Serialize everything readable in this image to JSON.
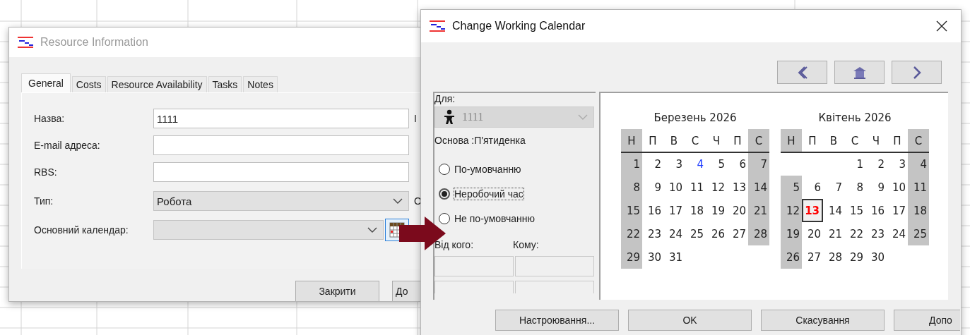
{
  "resource_window": {
    "title": "Resource Information",
    "active": false,
    "tabs": [
      {
        "label": "General",
        "selected": true
      },
      {
        "label": "Costs",
        "selected": false
      },
      {
        "label": "Resource Availability",
        "selected": false
      },
      {
        "label": "Tasks",
        "selected": false
      },
      {
        "label": "Notes",
        "selected": false
      }
    ],
    "fields": [
      {
        "kind": "text",
        "label": "Назва:",
        "value": "1111",
        "side_text": "І"
      },
      {
        "kind": "text",
        "label": "E-mail адреса:"
      },
      {
        "kind": "text",
        "label": "RBS:"
      },
      {
        "kind": "select",
        "label": "Тип:",
        "value": "Робота",
        "side_text": "О"
      },
      {
        "kind": "select",
        "label": "Основний календар:",
        "calendar_button": true
      }
    ],
    "buttons": [
      "Закрити",
      "До"
    ]
  },
  "calendar_window": {
    "title": "Change Working Calendar",
    "active": true,
    "for_label": "Для:",
    "resource": {
      "value": "1111",
      "disabled": true
    },
    "base_text": "Основа :П'ятиденка",
    "options": [
      {
        "label": "По-умовчанню",
        "selected": false,
        "focused": false
      },
      {
        "label": "Неробочий час",
        "selected": true,
        "focused": true
      },
      {
        "label": "Не по-умовчанню",
        "selected": false,
        "focused": false
      }
    ],
    "from_label": "Від кого:",
    "to_label": "Кому:",
    "months": [
      {
        "title": "Березень 2026",
        "weekdays": [
          {
            "label": "Н",
            "weekend": true
          },
          {
            "label": "П",
            "weekend": false
          },
          {
            "label": "В",
            "weekend": false
          },
          {
            "label": "С",
            "weekend": false
          },
          {
            "label": "Ч",
            "weekend": false
          },
          {
            "label": "П",
            "weekend": false
          },
          {
            "label": "С",
            "weekend": true
          }
        ],
        "weeks": [
          [
            {
              "day": "1",
              "weekend": true,
              "selected": false,
              "exception": false
            },
            {
              "day": "2",
              "weekend": false,
              "selected": false,
              "exception": false
            },
            {
              "day": "3",
              "weekend": false,
              "selected": false,
              "exception": false
            },
            {
              "day": "4",
              "weekend": false,
              "selected": false,
              "exception": true
            },
            {
              "day": "5",
              "weekend": false,
              "selected": false,
              "exception": false
            },
            {
              "day": "6",
              "weekend": false,
              "selected": false,
              "exception": false
            },
            {
              "day": "7",
              "weekend": true,
              "selected": false,
              "exception": false
            }
          ],
          [
            {
              "day": "8",
              "weekend": true,
              "selected": false,
              "exception": false
            },
            {
              "day": "9",
              "weekend": false,
              "selected": false,
              "exception": false
            },
            {
              "day": "10",
              "weekend": false,
              "selected": false,
              "exception": false
            },
            {
              "day": "11",
              "weekend": false,
              "selected": false,
              "exception": false
            },
            {
              "day": "12",
              "weekend": false,
              "selected": false,
              "exception": false
            },
            {
              "day": "13",
              "weekend": false,
              "selected": false,
              "exception": false
            },
            {
              "day": "14",
              "weekend": true,
              "selected": false,
              "exception": false
            }
          ],
          [
            {
              "day": "15",
              "weekend": true,
              "selected": false,
              "exception": false
            },
            {
              "day": "16",
              "weekend": false,
              "selected": false,
              "exception": false
            },
            {
              "day": "17",
              "weekend": false,
              "selected": false,
              "exception": false
            },
            {
              "day": "18",
              "weekend": false,
              "selected": false,
              "exception": false
            },
            {
              "day": "19",
              "weekend": false,
              "selected": false,
              "exception": false
            },
            {
              "day": "20",
              "weekend": false,
              "selected": false,
              "exception": false
            },
            {
              "day": "21",
              "weekend": true,
              "selected": false,
              "exception": false
            }
          ],
          [
            {
              "day": "22",
              "weekend": true,
              "selected": false,
              "exception": false
            },
            {
              "day": "23",
              "weekend": false,
              "selected": false,
              "exception": false
            },
            {
              "day": "24",
              "weekend": false,
              "selected": false,
              "exception": false
            },
            {
              "day": "25",
              "weekend": false,
              "selected": false,
              "exception": false
            },
            {
              "day": "26",
              "weekend": false,
              "selected": false,
              "exception": false
            },
            {
              "day": "27",
              "weekend": false,
              "selected": false,
              "exception": false
            },
            {
              "day": "28",
              "weekend": true,
              "selected": false,
              "exception": false
            }
          ],
          [
            {
              "day": "29",
              "weekend": true,
              "selected": false,
              "exception": false
            },
            {
              "day": "30",
              "weekend": false,
              "selected": false,
              "exception": false
            },
            {
              "day": "31",
              "weekend": false,
              "selected": false,
              "exception": false
            },
            {
              "kind": "blank"
            },
            {
              "kind": "blank"
            },
            {
              "kind": "blank"
            },
            {
              "kind": "blank"
            }
          ]
        ]
      },
      {
        "title": "Квітень 2026",
        "weekdays": [
          {
            "label": "Н",
            "weekend": true
          },
          {
            "label": "П",
            "weekend": false
          },
          {
            "label": "В",
            "weekend": false
          },
          {
            "label": "С",
            "weekend": false
          },
          {
            "label": "Ч",
            "weekend": false
          },
          {
            "label": "П",
            "weekend": false
          },
          {
            "label": "С",
            "weekend": true
          }
        ],
        "weeks": [
          [
            {
              "kind": "blank"
            },
            {
              "kind": "blank"
            },
            {
              "kind": "blank"
            },
            {
              "day": "1",
              "weekend": false,
              "selected": false,
              "exception": false
            },
            {
              "day": "2",
              "weekend": false,
              "selected": false,
              "exception": false
            },
            {
              "day": "3",
              "weekend": false,
              "selected": false,
              "exception": false
            },
            {
              "day": "4",
              "weekend": true,
              "selected": false,
              "exception": false
            }
          ],
          [
            {
              "day": "5",
              "weekend": true,
              "selected": false,
              "exception": false
            },
            {
              "day": "6",
              "weekend": false,
              "selected": false,
              "exception": false
            },
            {
              "day": "7",
              "weekend": false,
              "selected": false,
              "exception": false
            },
            {
              "day": "8",
              "weekend": false,
              "selected": false,
              "exception": false
            },
            {
              "day": "9",
              "weekend": false,
              "selected": false,
              "exception": false
            },
            {
              "day": "10",
              "weekend": false,
              "selected": false,
              "exception": false
            },
            {
              "day": "11",
              "weekend": true,
              "selected": false,
              "exception": false
            }
          ],
          [
            {
              "day": "12",
              "weekend": true,
              "selected": false,
              "exception": false
            },
            {
              "day": "13",
              "weekend": false,
              "selected": true,
              "exception": false
            },
            {
              "day": "14",
              "weekend": false,
              "selected": false,
              "exception": false
            },
            {
              "day": "15",
              "weekend": false,
              "selected": false,
              "exception": false
            },
            {
              "day": "16",
              "weekend": false,
              "selected": false,
              "exception": false
            },
            {
              "day": "17",
              "weekend": false,
              "selected": false,
              "exception": false
            },
            {
              "day": "18",
              "weekend": true,
              "selected": false,
              "exception": false
            }
          ],
          [
            {
              "day": "19",
              "weekend": true,
              "selected": false,
              "exception": false
            },
            {
              "day": "20",
              "weekend": false,
              "selected": false,
              "exception": false
            },
            {
              "day": "21",
              "weekend": false,
              "selected": false,
              "exception": false
            },
            {
              "day": "22",
              "weekend": false,
              "selected": false,
              "exception": false
            },
            {
              "day": "23",
              "weekend": false,
              "selected": false,
              "exception": false
            },
            {
              "day": "24",
              "weekend": false,
              "selected": false,
              "exception": false
            },
            {
              "day": "25",
              "weekend": true,
              "selected": false,
              "exception": false
            }
          ],
          [
            {
              "day": "26",
              "weekend": true,
              "selected": false,
              "exception": false
            },
            {
              "day": "27",
              "weekend": false,
              "selected": false,
              "exception": false
            },
            {
              "day": "28",
              "weekend": false,
              "selected": false,
              "exception": false
            },
            {
              "day": "29",
              "weekend": false,
              "selected": false,
              "exception": false
            },
            {
              "day": "30",
              "weekend": false,
              "selected": false,
              "exception": false
            },
            {
              "kind": "blank"
            },
            {
              "kind": "blank"
            }
          ]
        ]
      }
    ],
    "buttons": [
      "Настроювання...",
      "OK",
      "Скасування",
      "Допо"
    ]
  }
}
